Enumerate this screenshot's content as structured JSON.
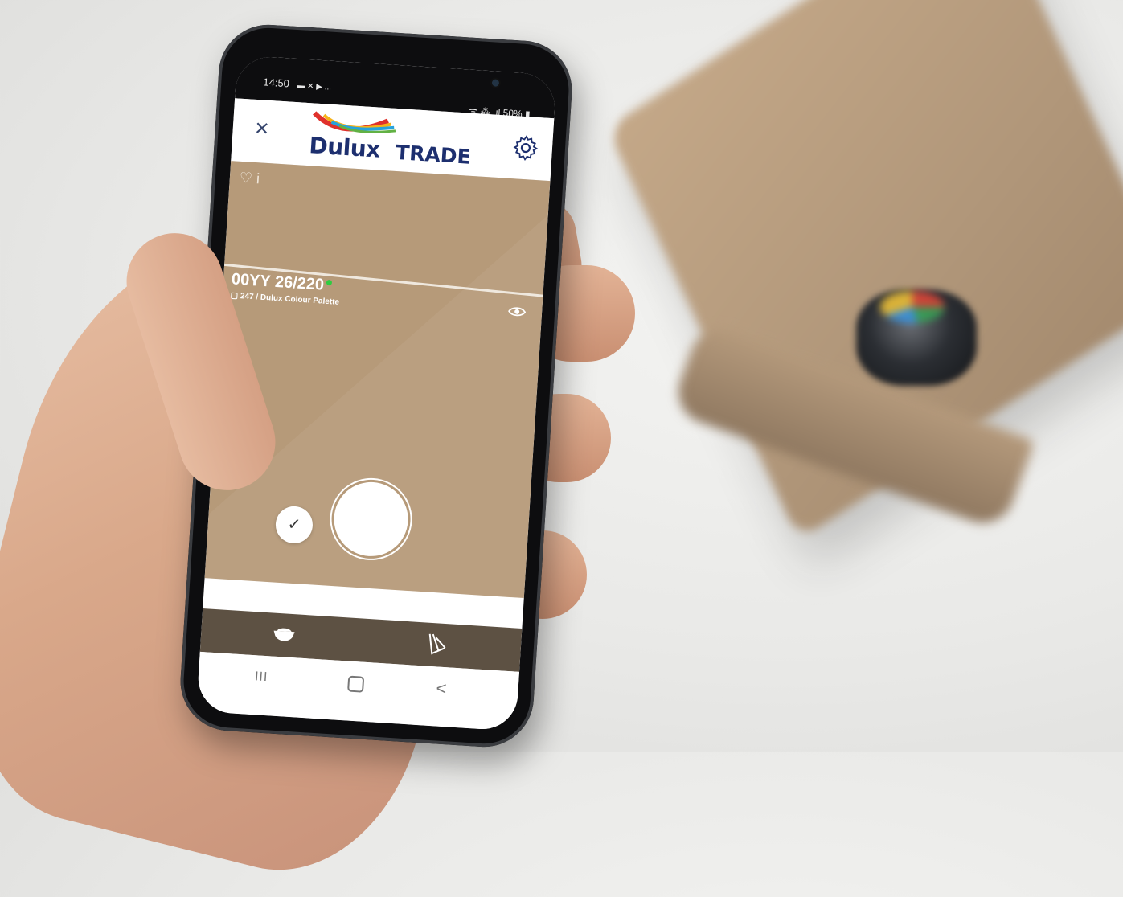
{
  "status_bar": {
    "time": "14:50",
    "left_icons": "▬ ✕ ▶ ...",
    "right_icons": "ᯤ ⁂ .ıl",
    "battery": "50%"
  },
  "app_bar": {
    "close_glyph": "×",
    "logo_brand": "Dulux",
    "logo_suffix": "TRADE"
  },
  "colour_reading": {
    "code": "00YY 26/220",
    "palette_info": "247 / Dulux Colour Palette",
    "swatch_color": "#b69a79"
  },
  "info_icons": "♡ i",
  "controls": {
    "check_glyph": "✓"
  },
  "system_nav": {
    "recent": "III",
    "back": "<"
  },
  "colors": {
    "brand_navy": "#1d2f6f",
    "nav_bar": "#5d5143",
    "sample_green": "#2ecc40"
  }
}
